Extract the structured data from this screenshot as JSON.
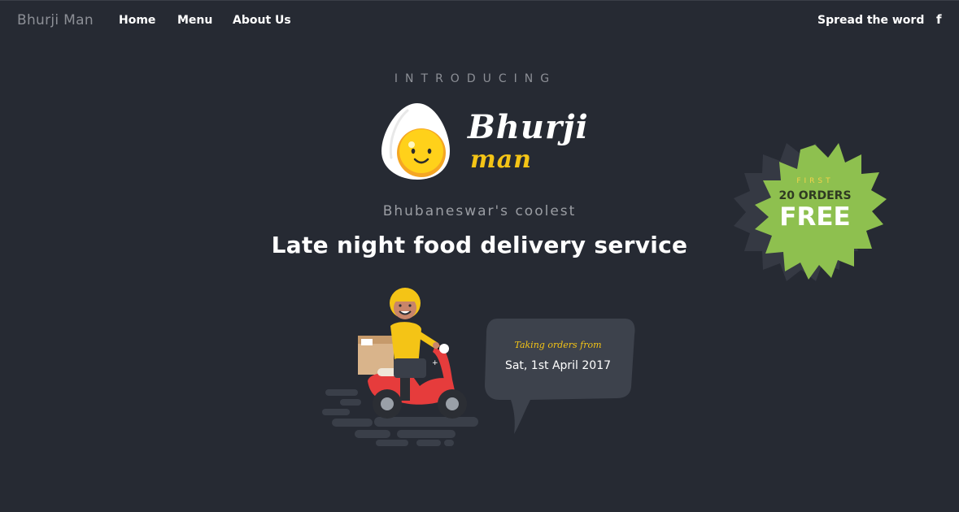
{
  "nav": {
    "brand": "Bhurji Man",
    "links": [
      "Home",
      "Menu",
      "About Us"
    ],
    "spread": "Spread the word",
    "facebook_icon_glyph": "f"
  },
  "hero": {
    "introducing": "INTRODUCING",
    "logo": {
      "word1": "Bhurji",
      "word2": "man"
    },
    "tagline": "Bhubaneswar's coolest",
    "headline": "Late night food delivery service"
  },
  "badge": {
    "first": "FIRST",
    "orders": "20 ORDERS",
    "free": "FREE"
  },
  "bubble": {
    "label": "Taking orders from",
    "date": "Sat, 1st April 2017"
  },
  "colors": {
    "background": "#262a33",
    "accent_yellow": "#f4c416",
    "badge_green": "#8ec04f",
    "scooter_red": "#e63c3c",
    "bubble": "#3d424c"
  },
  "icons": [
    "facebook-icon",
    "egg-mascot-icon",
    "starburst-badge",
    "delivery-rider-illustration",
    "speech-bubble"
  ]
}
